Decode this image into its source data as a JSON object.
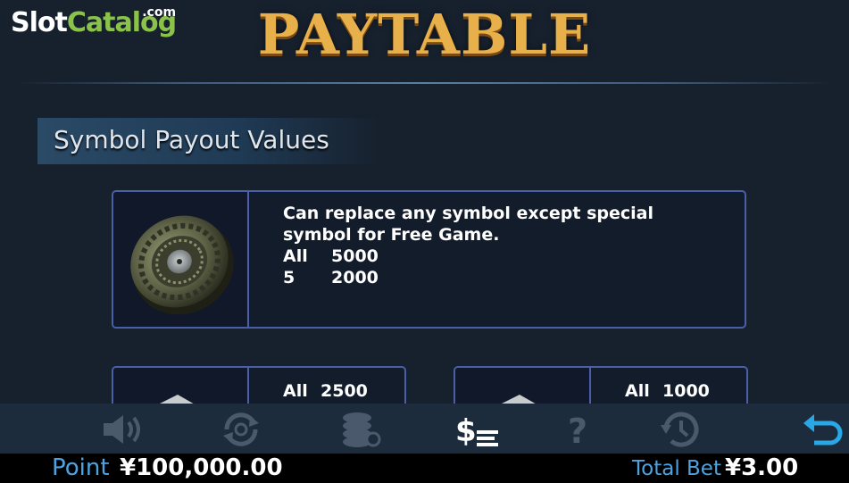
{
  "brand": {
    "slot": "Slot",
    "catalog": "Catalog",
    "com": ".com"
  },
  "header": {
    "title": "PAYTABLE"
  },
  "section": {
    "title": "Symbol Payout Values"
  },
  "cards": [
    {
      "symbol_icon": "compass-icon",
      "text_line1": "Can replace any symbol except special",
      "text_line2": "symbol for Free Game.",
      "pays": [
        {
          "count": "All",
          "value": "5000"
        },
        {
          "count": "5",
          "value": "2000"
        }
      ]
    },
    {
      "symbol_icon": "silver-ingot-icon",
      "pays": [
        {
          "count": "All",
          "value": "2500"
        }
      ]
    },
    {
      "symbol_icon": "silver-ingot-icon",
      "pays": [
        {
          "count": "All",
          "value": "1000"
        }
      ]
    }
  ],
  "toolbar": {
    "icons": [
      "sound-icon",
      "autoplay-icon",
      "chips-settings-icon",
      "paytable-icon",
      "help-icon",
      "history-icon",
      "back-icon"
    ],
    "active_color": "#ffffff",
    "inactive_color": "#4a5a6c",
    "back_color": "#2aa8e6"
  },
  "status": {
    "point_label": "Point",
    "point_value": "¥100,000.00",
    "bet_label": "Total Bet",
    "bet_value": "¥3.00"
  }
}
